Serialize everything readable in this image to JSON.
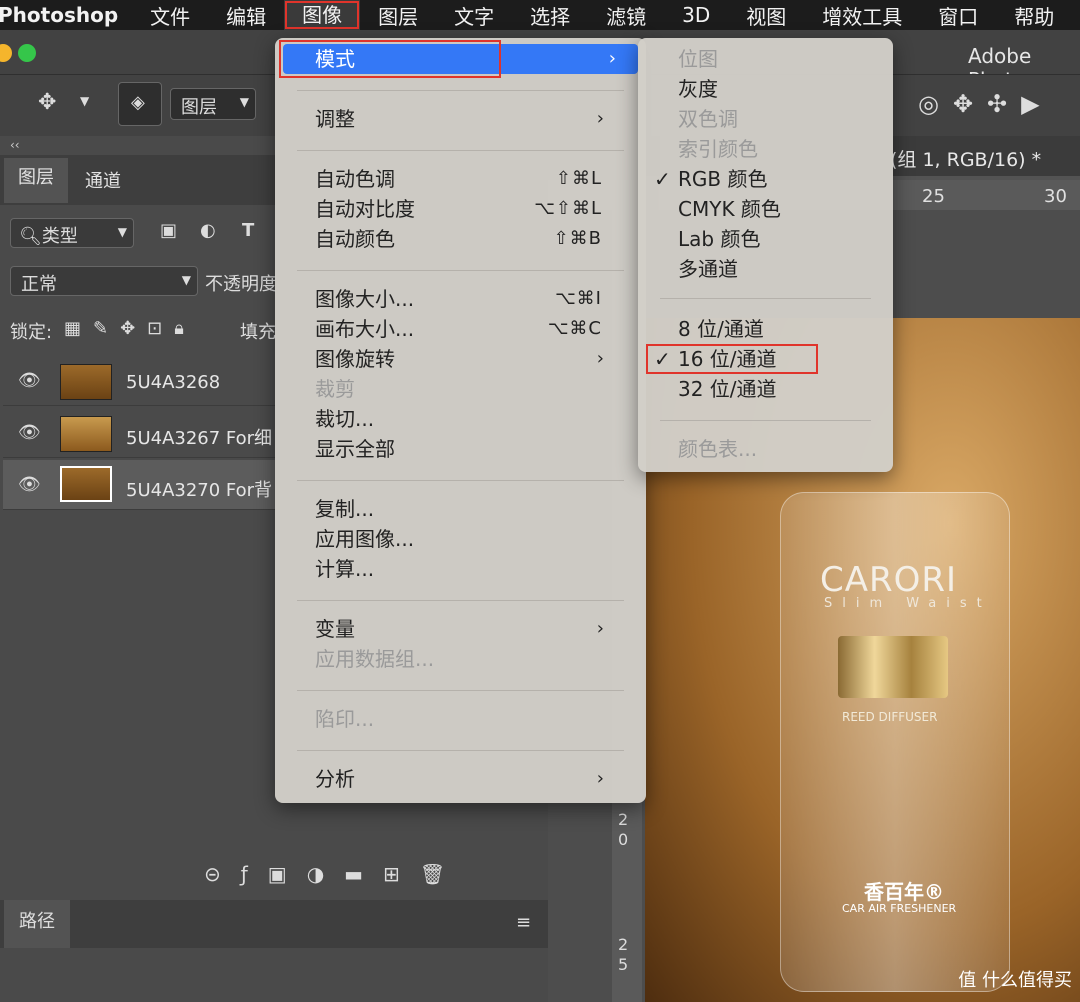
{
  "menubar": {
    "app": "Photoshop",
    "items": [
      "文件",
      "编辑",
      "图像",
      "图层",
      "文字",
      "选择",
      "滤镜",
      "3D",
      "视图",
      "增效工具",
      "窗口",
      "帮助"
    ]
  },
  "window": {
    "title": "Adobe Phot"
  },
  "toolbar": {
    "layer_select": "图层"
  },
  "doc_tab": {
    "title": "(组 1, RGB/16) *"
  },
  "ruler": {
    "top": [
      "25",
      "30"
    ],
    "left": [
      "2",
      "0",
      "2",
      "5"
    ]
  },
  "panel": {
    "tabs": [
      "图层",
      "通道"
    ],
    "collapse": "‹‹",
    "filter": "类型",
    "blend": "正常",
    "opacity_label": "不透明度",
    "lock_label": "锁定:",
    "fill_label": "填充",
    "layers": [
      "5U4A3268",
      "5U4A3267 For细",
      "5U4A3270 For背"
    ],
    "paths_tab": "路径"
  },
  "image_menu": {
    "items": [
      {
        "label": "模式",
        "arrow": true,
        "highlight": true
      },
      {
        "label": "调整",
        "arrow": true
      },
      {
        "label": "自动色调",
        "shortcut": "⇧⌘L"
      },
      {
        "label": "自动对比度",
        "shortcut": "⌥⇧⌘L"
      },
      {
        "label": "自动颜色",
        "shortcut": "⇧⌘B"
      },
      {
        "label": "图像大小...",
        "shortcut": "⌥⌘I"
      },
      {
        "label": "画布大小...",
        "shortcut": "⌥⌘C"
      },
      {
        "label": "图像旋转",
        "arrow": true
      },
      {
        "label": "裁剪",
        "disabled": true
      },
      {
        "label": "裁切..."
      },
      {
        "label": "显示全部"
      },
      {
        "label": "复制..."
      },
      {
        "label": "应用图像..."
      },
      {
        "label": "计算..."
      },
      {
        "label": "变量",
        "arrow": true
      },
      {
        "label": "应用数据组...",
        "disabled": true
      },
      {
        "label": "陷印...",
        "disabled": true
      },
      {
        "label": "分析",
        "arrow": true
      }
    ]
  },
  "mode_menu": {
    "items": [
      {
        "label": "位图",
        "disabled": true
      },
      {
        "label": "灰度"
      },
      {
        "label": "双色调",
        "disabled": true
      },
      {
        "label": "索引颜色",
        "disabled": true
      },
      {
        "label": "RGB 颜色",
        "checked": true
      },
      {
        "label": "CMYK 颜色"
      },
      {
        "label": "Lab 颜色"
      },
      {
        "label": "多通道"
      },
      {
        "label": "8 位/通道"
      },
      {
        "label": "16 位/通道",
        "checked": true
      },
      {
        "label": "32 位/通道"
      },
      {
        "label": "颜色表...",
        "disabled": true
      }
    ]
  },
  "product": {
    "brand": "CARORI",
    "sub": "Slim Waist",
    "label1": "REED DIFFUSER",
    "label2": "香百年®",
    "label3": "CAR AIR FRESHENER"
  },
  "watermark": "值 什么值得买",
  "colors": {
    "menu_highlight": "#3478f6",
    "annotation": "#e0342b"
  }
}
